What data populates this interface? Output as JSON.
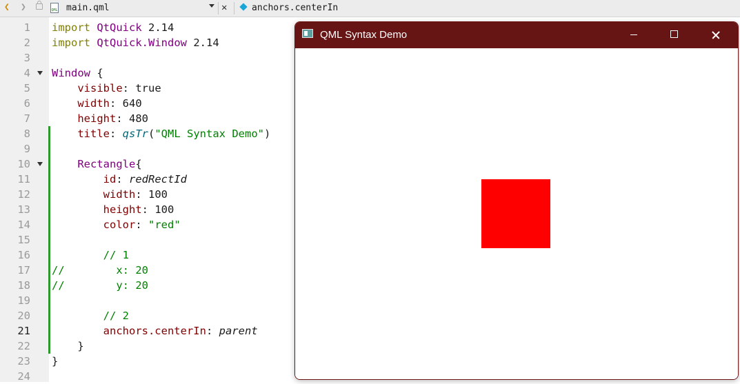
{
  "topbar": {
    "file_name": "main.qml",
    "file_icon_text": "QML",
    "symbol": "anchors.centerIn",
    "back_arrow": "❮",
    "forward_arrow": "❯",
    "close_glyph": "✕"
  },
  "editor": {
    "current_line": 21,
    "lines": [
      {
        "n": "1",
        "segs": [
          [
            "k",
            "import"
          ],
          [
            "v",
            " "
          ],
          [
            "t",
            "QtQuick"
          ],
          [
            "v",
            " 2.14"
          ]
        ]
      },
      {
        "n": "2",
        "segs": [
          [
            "k",
            "import"
          ],
          [
            "v",
            " "
          ],
          [
            "t",
            "QtQuick.Window"
          ],
          [
            "v",
            " 2.14"
          ]
        ]
      },
      {
        "n": "3",
        "segs": []
      },
      {
        "n": "4",
        "fold": true,
        "segs": [
          [
            "t",
            "Window"
          ],
          [
            "v",
            " {"
          ]
        ]
      },
      {
        "n": "5",
        "segs": [
          [
            "v",
            "    "
          ],
          [
            "p",
            "visible"
          ],
          [
            "v",
            ": true"
          ]
        ]
      },
      {
        "n": "6",
        "segs": [
          [
            "v",
            "    "
          ],
          [
            "p",
            "width"
          ],
          [
            "v",
            ": 640"
          ]
        ]
      },
      {
        "n": "7",
        "segs": [
          [
            "v",
            "    "
          ],
          [
            "p",
            "height"
          ],
          [
            "v",
            ": 480"
          ]
        ]
      },
      {
        "n": "8",
        "mark": true,
        "segs": [
          [
            "v",
            "    "
          ],
          [
            "p",
            "title"
          ],
          [
            "v",
            ": "
          ],
          [
            "f",
            "qsTr"
          ],
          [
            "v",
            "("
          ],
          [
            "s",
            "\"QML Syntax Demo\""
          ],
          [
            "v",
            ")"
          ]
        ]
      },
      {
        "n": "9",
        "mark": true,
        "segs": []
      },
      {
        "n": "10",
        "mark": true,
        "fold": true,
        "segs": [
          [
            "v",
            "    "
          ],
          [
            "t",
            "Rectangle"
          ],
          [
            "v",
            "{"
          ]
        ]
      },
      {
        "n": "11",
        "mark": true,
        "segs": [
          [
            "v",
            "        "
          ],
          [
            "p",
            "id"
          ],
          [
            "v",
            ": "
          ],
          [
            "i",
            "redRectId"
          ]
        ]
      },
      {
        "n": "12",
        "mark": true,
        "segs": [
          [
            "v",
            "        "
          ],
          [
            "p",
            "width"
          ],
          [
            "v",
            ": 100"
          ]
        ]
      },
      {
        "n": "13",
        "mark": true,
        "segs": [
          [
            "v",
            "        "
          ],
          [
            "p",
            "height"
          ],
          [
            "v",
            ": 100"
          ]
        ]
      },
      {
        "n": "14",
        "mark": true,
        "segs": [
          [
            "v",
            "        "
          ],
          [
            "p",
            "color"
          ],
          [
            "v",
            ": "
          ],
          [
            "s",
            "\"red\""
          ]
        ]
      },
      {
        "n": "15",
        "mark": true,
        "segs": []
      },
      {
        "n": "16",
        "mark": true,
        "segs": [
          [
            "v",
            "        "
          ],
          [
            "c",
            "// 1"
          ]
        ]
      },
      {
        "n": "17",
        "mark": true,
        "segs": [
          [
            "c",
            "//        x: 20"
          ]
        ]
      },
      {
        "n": "18",
        "mark": true,
        "segs": [
          [
            "c",
            "//        y: 20"
          ]
        ]
      },
      {
        "n": "19",
        "mark": true,
        "segs": []
      },
      {
        "n": "20",
        "mark": true,
        "segs": [
          [
            "v",
            "        "
          ],
          [
            "c",
            "// 2"
          ]
        ]
      },
      {
        "n": "21",
        "mark": true,
        "segs": [
          [
            "v",
            "        "
          ],
          [
            "p",
            "anchors.centerIn"
          ],
          [
            "v",
            ": "
          ],
          [
            "i",
            "parent"
          ]
        ]
      },
      {
        "n": "22",
        "mark": true,
        "segs": [
          [
            "v",
            "    }"
          ]
        ]
      },
      {
        "n": "23",
        "segs": [
          [
            "v",
            "}"
          ]
        ]
      },
      {
        "n": "24",
        "segs": []
      }
    ]
  },
  "window": {
    "title": "QML Syntax Demo",
    "rect_color": "#ff0000"
  },
  "colors": {
    "titlebar": "#671414",
    "keyword": "#808000",
    "type": "#800080",
    "property": "#800000",
    "string": "#008000",
    "change_marker": "#2e9a2e"
  }
}
